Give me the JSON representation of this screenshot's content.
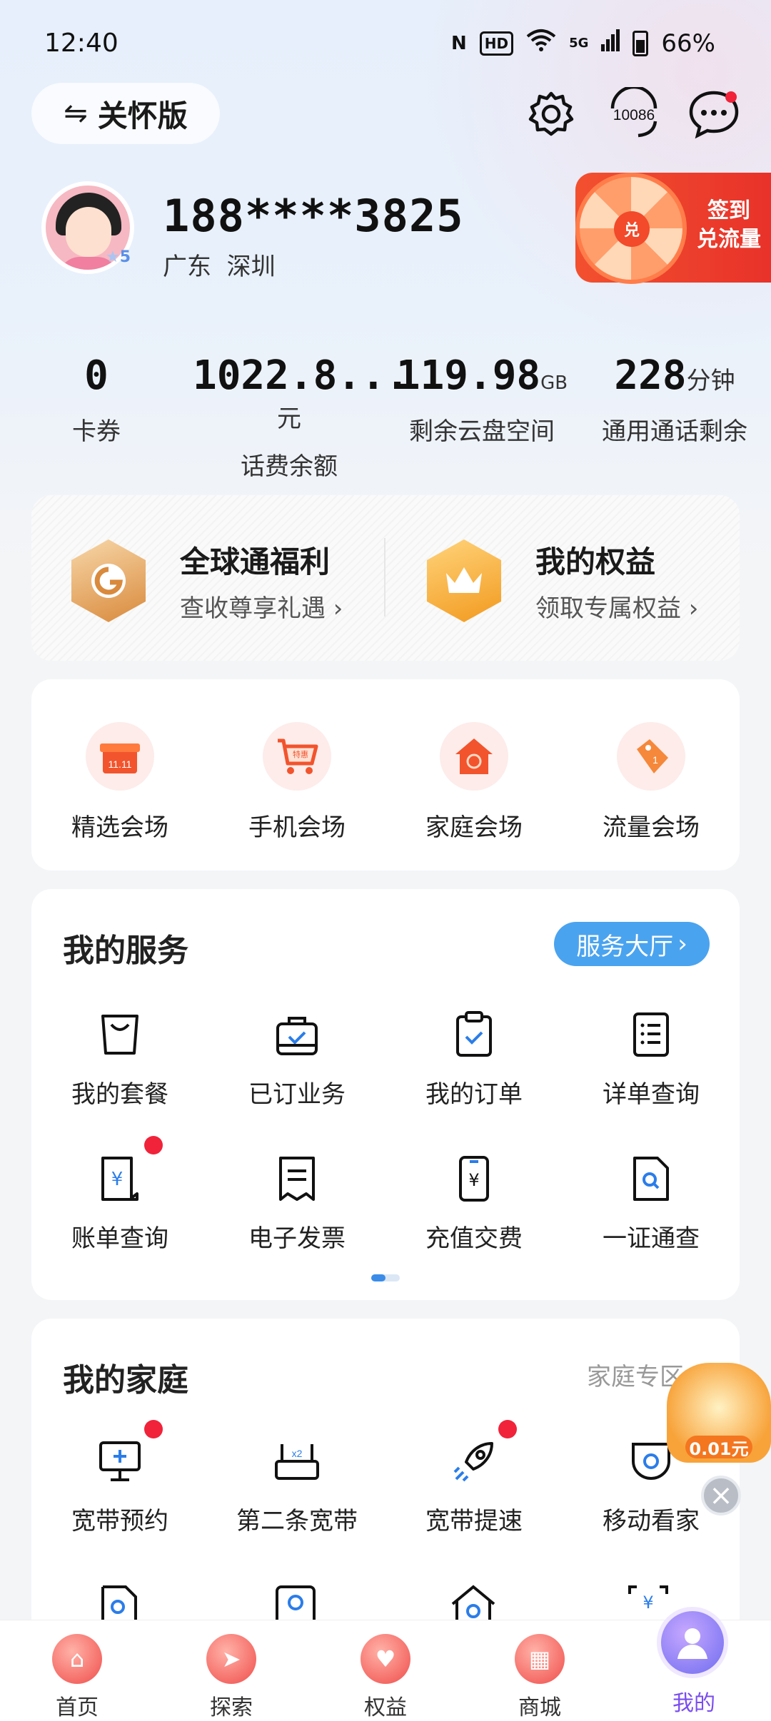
{
  "status_bar": {
    "time": "12:40",
    "nfc": "N",
    "hd": "HD",
    "signal": "5G",
    "battery": "66%"
  },
  "header": {
    "care_mode_label": "关怀版",
    "care_mode_icon": "swap-icon",
    "service_number": "10086"
  },
  "user": {
    "phone": "188****3825",
    "province": "广东",
    "city": "深圳",
    "level": "5",
    "checkin_badge": "兑",
    "checkin_line1": "签到",
    "checkin_line2": "兑流量"
  },
  "stats": [
    {
      "value": "0",
      "unit": "",
      "label": "卡券"
    },
    {
      "value": "1022.8...",
      "unit": "元",
      "label": "话费余额"
    },
    {
      "value": "119.98",
      "unit": "GB",
      "label": "剩余云盘空间"
    },
    {
      "value": "228",
      "unit": "分钟",
      "label": "通用通话剩余"
    }
  ],
  "perks": [
    {
      "title": "全球通福利",
      "subtitle": "查收尊享礼遇 ›",
      "icon": "global-pass-icon"
    },
    {
      "title": "我的权益",
      "subtitle": "领取专属权益 ›",
      "icon": "crown-icon"
    }
  ],
  "venues": [
    {
      "label": "精选会场",
      "badge": "11.11",
      "icon": "gift-icon"
    },
    {
      "label": "手机会场",
      "badge": "特惠",
      "icon": "cart-icon"
    },
    {
      "label": "家庭会场",
      "badge": "",
      "icon": "house-icon"
    },
    {
      "label": "流量会场",
      "badge": "1",
      "icon": "tag-icon"
    }
  ],
  "services": {
    "title": "我的服务",
    "hall_button": "服务大厅",
    "items": [
      {
        "label": "我的套餐",
        "icon": "bag-icon"
      },
      {
        "label": "已订业务",
        "icon": "briefcase-check-icon"
      },
      {
        "label": "我的订单",
        "icon": "clipboard-check-icon"
      },
      {
        "label": "详单查询",
        "icon": "list-doc-icon"
      },
      {
        "label": "账单查询",
        "icon": "bill-yen-icon"
      },
      {
        "label": "电子发票",
        "icon": "invoice-icon"
      },
      {
        "label": "充值交费",
        "icon": "phone-yen-icon"
      },
      {
        "label": "一证通查",
        "icon": "doc-search-icon"
      }
    ]
  },
  "family": {
    "title": "我的家庭",
    "zone_link": "家庭专区 ›",
    "items": [
      {
        "label": "宽带预约",
        "icon": "monitor-plus-icon"
      },
      {
        "label": "第二条宽带",
        "icon": "router-x2-icon"
      },
      {
        "label": "宽带提速",
        "icon": "rocket-icon"
      },
      {
        "label": "移动看家",
        "icon": "camera-icon"
      }
    ]
  },
  "float_ad": {
    "price": "0.01元"
  },
  "bottom_nav": [
    {
      "label": "首页",
      "icon": "home-icon"
    },
    {
      "label": "探索",
      "icon": "compass-icon"
    },
    {
      "label": "权益",
      "icon": "heart-gift-icon"
    },
    {
      "label": "商城",
      "icon": "shop-icon"
    },
    {
      "label": "我的",
      "icon": "person-icon",
      "active": true
    }
  ],
  "colors": {
    "accent_blue": "#4aa3ef",
    "active_nav": "#7a4df0",
    "red": "#f0233a"
  }
}
